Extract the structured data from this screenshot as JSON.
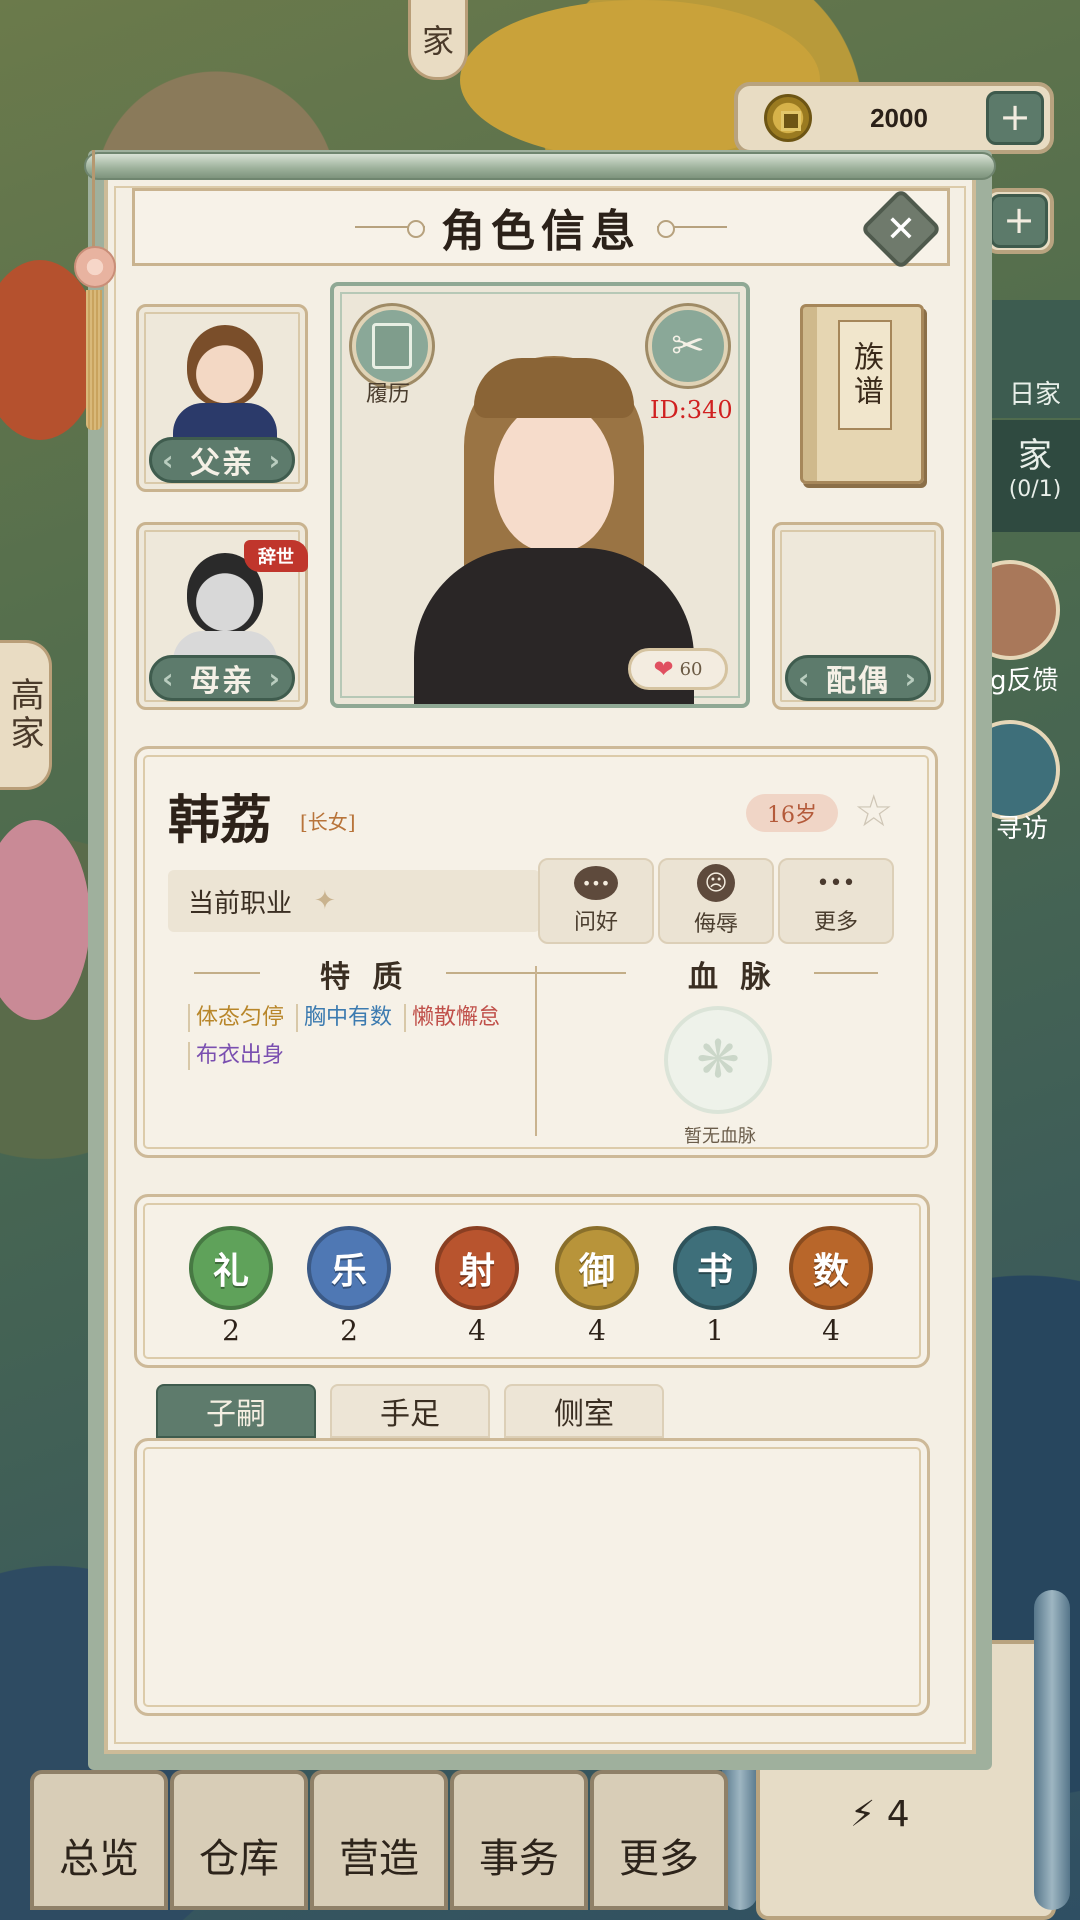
{
  "background": {
    "top_tab": "家",
    "side_tab": "高家",
    "currency": {
      "value": "2000",
      "plus": "+"
    },
    "side_labels": [
      "日家",
      "家",
      "(0/1)",
      "g反馈",
      "寻访"
    ],
    "bottom_nav": [
      "总览",
      "仓库",
      "营造",
      "事务",
      "更多"
    ],
    "energy": "4"
  },
  "panel": {
    "title": "角色信息",
    "close": "✕"
  },
  "family": {
    "father_label": "父亲",
    "mother_label": "母亲",
    "mother_status": "辞世",
    "spouse_label": "配偶",
    "genealogy_book": "族谱"
  },
  "character": {
    "resume_label": "履历",
    "id": "ID:340",
    "affection": "60",
    "name": "韩荔",
    "rank": "[长女]",
    "age": "16岁",
    "job_label": "当前职业",
    "actions": [
      {
        "label": "问好",
        "icon": "speech-icon",
        "glyph": "•••"
      },
      {
        "label": "侮辱",
        "icon": "angry-face-icon",
        "glyph": "☹"
      },
      {
        "label": "更多",
        "icon": "more-icon",
        "glyph": "•••"
      }
    ],
    "traits_title": "特 质",
    "traits": [
      {
        "text": "体态匀停",
        "color": "#b8862a"
      },
      {
        "text": "胸中有数",
        "color": "#3c7bb0"
      },
      {
        "text": "懒散懈怠",
        "color": "#c0504a"
      },
      {
        "text": "布衣出身",
        "color": "#7a4fb0"
      }
    ],
    "bloodline_title": "血 脉",
    "bloodline_empty": "暂无血脉"
  },
  "attributes": [
    {
      "name": "礼",
      "value": "2",
      "color": "#5fa25a"
    },
    {
      "name": "乐",
      "value": "2",
      "color": "#4f78b4"
    },
    {
      "name": "射",
      "value": "4",
      "color": "#b8542e"
    },
    {
      "name": "御",
      "value": "4",
      "color": "#b8943a"
    },
    {
      "name": "书",
      "value": "1",
      "color": "#3e6f7a"
    },
    {
      "name": "数",
      "value": "4",
      "color": "#b8662a"
    }
  ],
  "tabs": [
    "子嗣",
    "手足",
    "侧室"
  ]
}
